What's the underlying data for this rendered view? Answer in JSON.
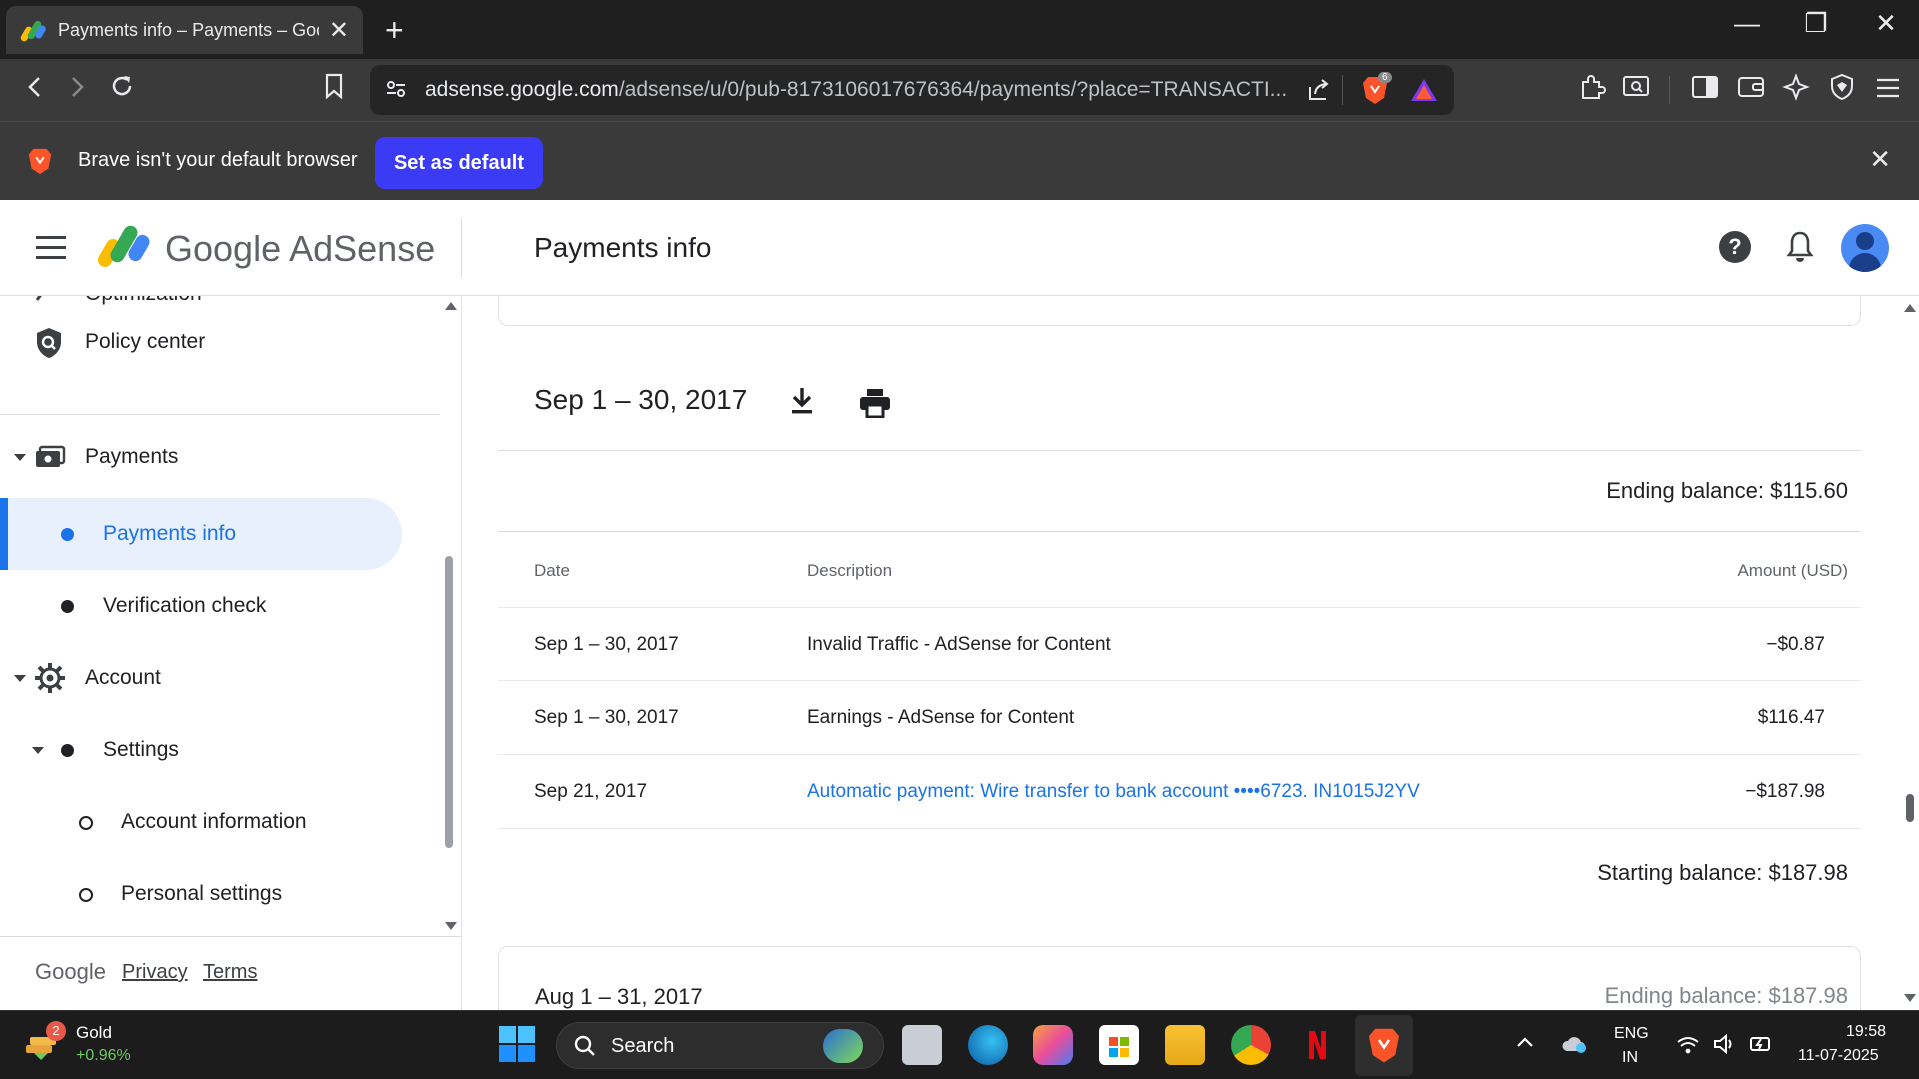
{
  "browser": {
    "tab_title": "Payments info – Payments – Google AdSense",
    "url_host": "adsense.google.com",
    "url_path": "/adsense/u/0/pub-8173106017676364/payments/?place=TRANSACTI...",
    "shield_count": "6",
    "infobar_text": "Brave isn't your default browser",
    "infobar_button": "Set as default"
  },
  "header": {
    "brand": "Google AdSense",
    "page_title": "Payments info",
    "help_glyph": "?"
  },
  "sidebar": {
    "partial_item": "Optimization",
    "items": [
      {
        "label": "Policy center",
        "icon": "policy-shield-icon"
      },
      {
        "label": "Payments",
        "icon": "payments-icon"
      },
      {
        "label": "Payments info",
        "icon": "dot"
      },
      {
        "label": "Verification check",
        "icon": "dot"
      },
      {
        "label": "Account",
        "icon": "gear-icon"
      },
      {
        "label": "Settings",
        "icon": "dot"
      },
      {
        "label": "Account information",
        "icon": "ring"
      },
      {
        "label": "Personal settings",
        "icon": "ring"
      }
    ],
    "footer": {
      "brand": "Google",
      "privacy": "Privacy",
      "terms": "Terms"
    }
  },
  "statement": {
    "period": "Sep 1 – 30, 2017",
    "ending_balance": "Ending balance: $115.60",
    "columns": {
      "date": "Date",
      "description": "Description",
      "amount": "Amount (USD)"
    },
    "rows": [
      {
        "date": "Sep 1 – 30, 2017",
        "description": "Invalid Traffic - AdSense for Content",
        "amount": "−$0.87"
      },
      {
        "date": "Sep 1 – 30, 2017",
        "description": "Earnings - AdSense for Content",
        "amount": "$116.47"
      },
      {
        "date": "Sep 21, 2017",
        "description": "Automatic payment: Wire transfer to bank account  ••••6723. IN1015J2YV",
        "amount": "−$187.98"
      }
    ],
    "starting_balance": "Starting balance: $187.98"
  },
  "next_statement": {
    "period": "Aug 1 – 31, 2017",
    "ending_balance": "Ending balance: $187.98"
  },
  "taskbar": {
    "widget_badge": "2",
    "widget_title": "Gold",
    "widget_change": "+0.96%",
    "search_placeholder": "Search",
    "lang_line1": "ENG",
    "lang_line2": "IN",
    "time": "19:58",
    "date": "11-07-2025"
  },
  "colors": {
    "accent": "#1a73e8",
    "active_nav_bg": "#e8f0fe",
    "brave_button": "#3b3bf5"
  }
}
